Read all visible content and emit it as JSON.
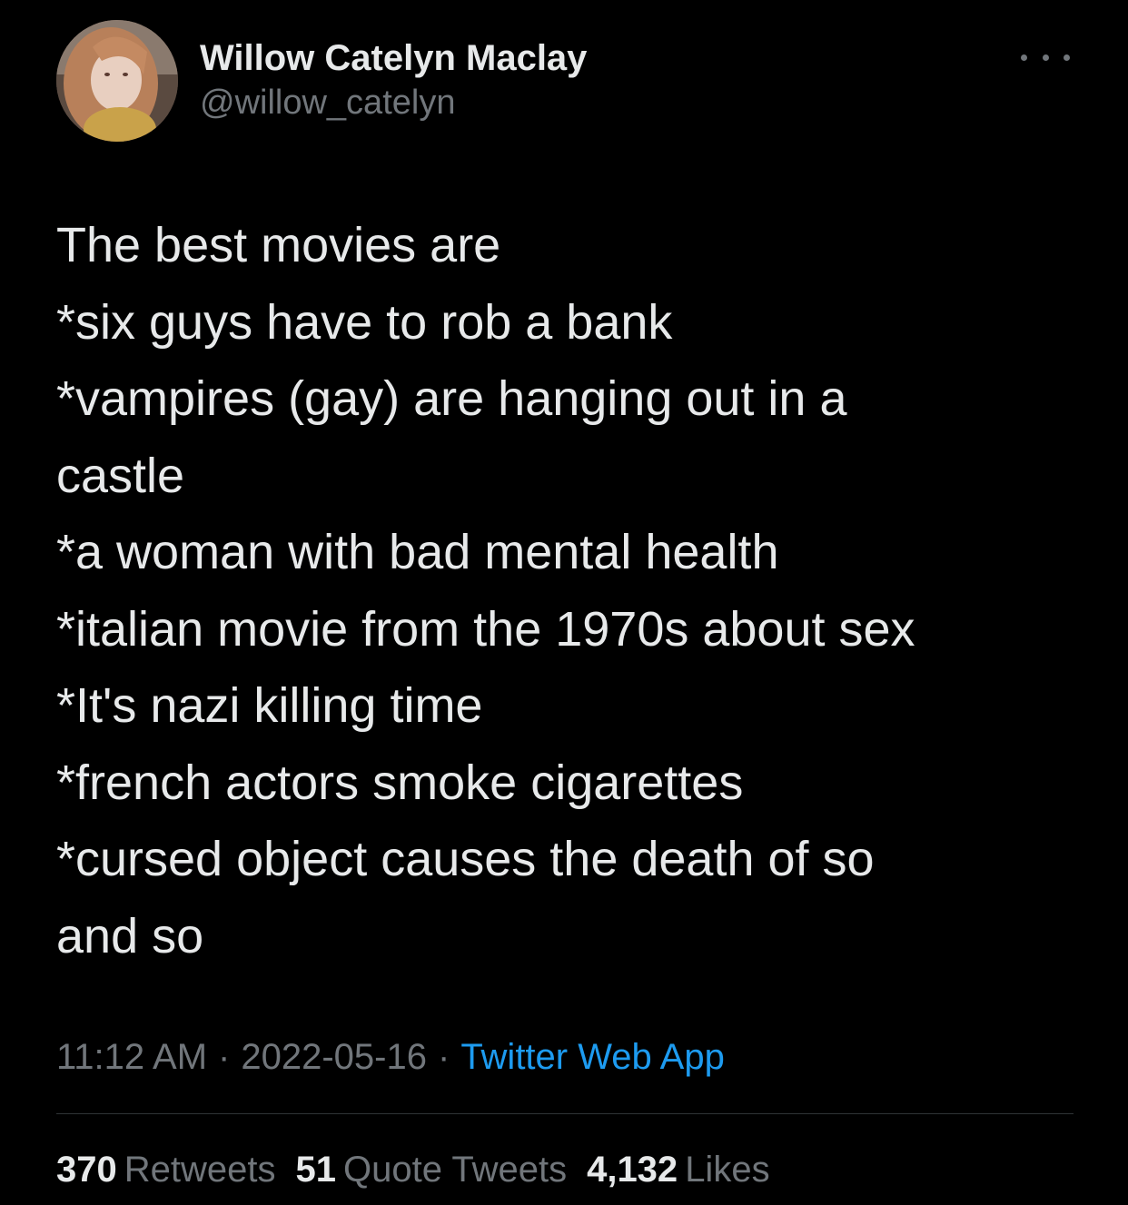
{
  "author": {
    "display_name": "Willow Catelyn Maclay",
    "handle": "@willow_catelyn"
  },
  "icons": {
    "more": "more-horizontal-icon",
    "avatar": "profile-photo"
  },
  "tweet": {
    "lines": [
      "The best movies are",
      "*six guys have to rob a bank",
      "*vampires (gay) are hanging out in a",
      "castle",
      "*a woman with bad mental health",
      "*italian movie from the 1970s about sex",
      "*It's nazi killing time",
      "*french actors smoke cigarettes",
      "*cursed object causes the death of so",
      "and so"
    ]
  },
  "meta": {
    "time": "11:12 AM",
    "separator": "·",
    "date": "2022-05-16",
    "source": "Twitter Web App"
  },
  "stats": {
    "retweets_count": "370",
    "retweets_label": "Retweets",
    "quotes_count": "51",
    "quotes_label": "Quote Tweets",
    "likes_count": "4,132",
    "likes_label": "Likes"
  },
  "colors": {
    "background": "#000000",
    "primary_text": "#e7e9ea",
    "secondary_text": "#71767b",
    "link": "#1d9bf0",
    "divider": "#2f3336"
  }
}
